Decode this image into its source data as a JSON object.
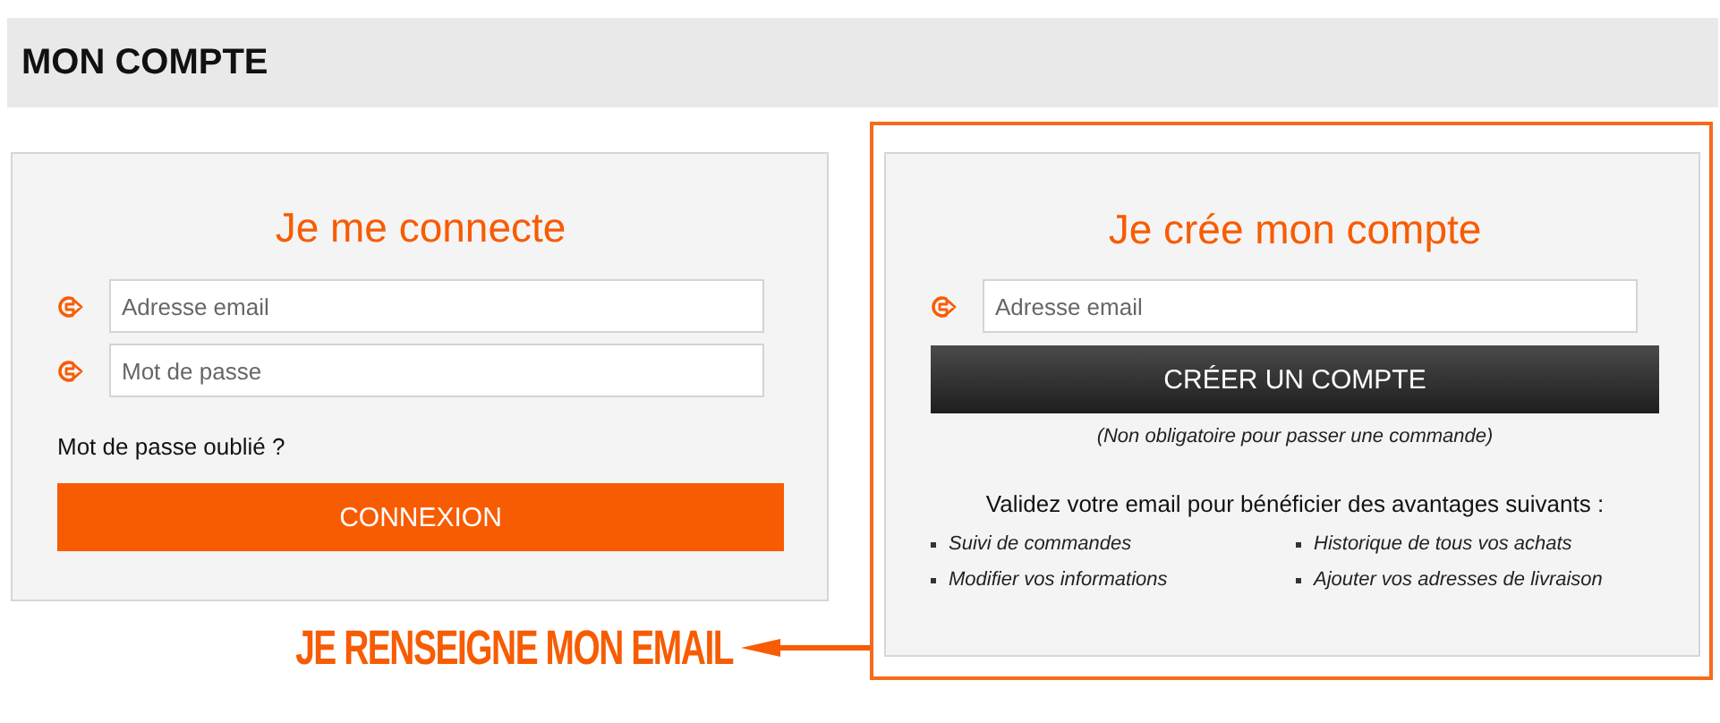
{
  "header": {
    "title": "MON COMPTE"
  },
  "login": {
    "title": "Je me connecte",
    "fields": [
      {
        "placeholder": "Adresse email"
      },
      {
        "placeholder": "Mot de passe"
      }
    ],
    "forgot_link": "Mot de passe oublié ?",
    "button": "CONNEXION"
  },
  "signup": {
    "highlighted": true,
    "title": "Je crée mon compte",
    "fields": [
      {
        "placeholder": "Adresse email"
      }
    ],
    "button": "CRÉER UN COMPTE",
    "note": "(Non obligatoire pour passer une commande)",
    "benefits_intro": "Validez votre email pour bénéficier des avantages suivants :",
    "benefits": [
      "Suivi de commandes",
      "Historique de tous vos achats",
      "Modifier vos informations",
      "Ajouter vos adresses de livraison"
    ]
  },
  "annotation": {
    "text": "JE RENSEIGNE MON EMAIL"
  }
}
